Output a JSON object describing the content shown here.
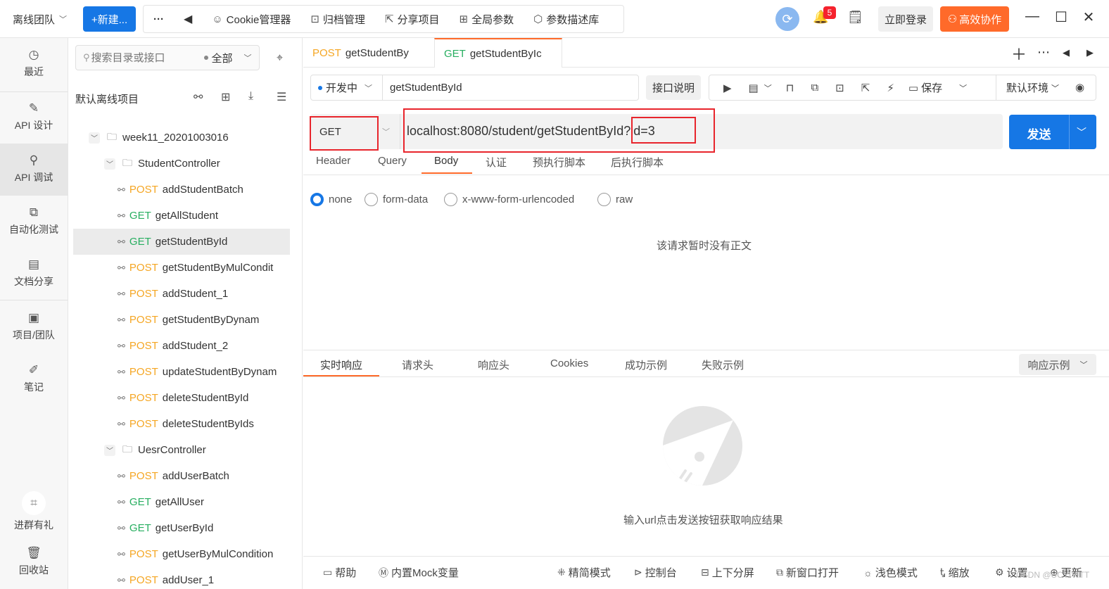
{
  "topbar": {
    "team": "离线团队",
    "new_label": "+新建...",
    "more_label": "···",
    "back_label": "◀",
    "tools": [
      {
        "icon": "cookie-icon",
        "glyph": "☺",
        "label": "Cookie管理器"
      },
      {
        "icon": "archive-icon",
        "glyph": "⊡",
        "label": "归档管理"
      },
      {
        "icon": "share-icon",
        "glyph": "⇱",
        "label": "分享项目"
      },
      {
        "icon": "params-icon",
        "glyph": "⊞",
        "label": "全局参数"
      },
      {
        "icon": "cube-icon",
        "glyph": "⬡",
        "label": "参数描述库"
      }
    ],
    "notification_count": "5",
    "login_label": "立即登录",
    "collab_label": "高效协作"
  },
  "rail": {
    "items": [
      {
        "label": "最近",
        "icon": "clock-icon",
        "glyph": "◷"
      },
      {
        "label": "API 设计",
        "icon": "edit-icon",
        "glyph": "✎"
      },
      {
        "label": "API 调试",
        "icon": "debug-icon",
        "glyph": "⚲"
      },
      {
        "label": "自动化测试",
        "icon": "flow-icon",
        "glyph": "⧉"
      },
      {
        "label": "文档分享",
        "icon": "doc-icon",
        "glyph": "▤"
      },
      {
        "label": "项目/团队",
        "icon": "project-icon",
        "glyph": "▣"
      },
      {
        "label": "笔记",
        "icon": "note-icon",
        "glyph": "✐"
      },
      {
        "label": "进群有礼",
        "icon": "group-icon",
        "glyph": "⌗"
      },
      {
        "label": "回收站",
        "icon": "trash-icon",
        "glyph": "🗑"
      }
    ]
  },
  "tree": {
    "search_placeholder": "搜索目录或接口",
    "filter_label": "全部",
    "project_title": "默认离线项目",
    "rows": [
      {
        "kind": "folder",
        "label": "week11_20201003016"
      },
      {
        "kind": "folder",
        "label": "StudentController"
      },
      {
        "kind": "api",
        "method": "POST",
        "label": "addStudentBatch"
      },
      {
        "kind": "api",
        "method": "GET",
        "label": "getAllStudent"
      },
      {
        "kind": "api",
        "method": "GET",
        "label": "getStudentById"
      },
      {
        "kind": "api",
        "method": "POST",
        "label": "getStudentByMulCondit"
      },
      {
        "kind": "api",
        "method": "POST",
        "label": "addStudent_1"
      },
      {
        "kind": "api",
        "method": "POST",
        "label": "getStudentByDynam"
      },
      {
        "kind": "api",
        "method": "POST",
        "label": "addStudent_2"
      },
      {
        "kind": "api",
        "method": "POST",
        "label": "updateStudentByDynam"
      },
      {
        "kind": "api",
        "method": "POST",
        "label": "deleteStudentById"
      },
      {
        "kind": "api",
        "method": "POST",
        "label": "deleteStudentByIds"
      },
      {
        "kind": "folder",
        "label": "UesrController"
      },
      {
        "kind": "api",
        "method": "POST",
        "label": "addUserBatch"
      },
      {
        "kind": "api",
        "method": "GET",
        "label": "getAllUser"
      },
      {
        "kind": "api",
        "method": "GET",
        "label": "getUserById"
      },
      {
        "kind": "api",
        "method": "POST",
        "label": "getUserByMulCondition"
      },
      {
        "kind": "api",
        "method": "POST",
        "label": "addUser_1"
      }
    ]
  },
  "tabs": [
    {
      "method": "POST",
      "label": "getStudentBy"
    },
    {
      "method": "GET",
      "label": "getStudentByIc"
    }
  ],
  "request": {
    "status": "开发中",
    "api_name": "getStudentById",
    "desc_label": "接口说明",
    "save_label": "保存",
    "env_label": "默认环境",
    "method": "GET",
    "url_base": "localhost:8080/student/getStudentById",
    "url_query": "?id=3",
    "send_label": "发送",
    "param_tabs": [
      "Header",
      "Query",
      "Body",
      "认证",
      "预执行脚本",
      "后执行脚本"
    ],
    "body_types": [
      "none",
      "form-data",
      "x-www-form-urlencoded",
      "raw"
    ],
    "no_body_text": "该请求暂时没有正文"
  },
  "response": {
    "tabs": [
      "实时响应",
      "请求头",
      "响应头",
      "Cookies",
      "成功示例",
      "失败示例"
    ],
    "example_label": "响应示例",
    "empty_hint": "输入url点击发送按钮获取响应结果"
  },
  "footer": {
    "items": [
      {
        "icon": "help-icon",
        "glyph": "▭",
        "label": "帮助"
      },
      {
        "icon": "mock-icon",
        "glyph": "Ⓜ",
        "label": "内置Mock变量"
      },
      {
        "icon": "simple-mode-icon",
        "glyph": "⁜",
        "label": "精简模式"
      },
      {
        "icon": "console-icon",
        "glyph": "⊳",
        "label": "控制台"
      },
      {
        "icon": "split-icon",
        "glyph": "⊟",
        "label": "上下分屏"
      },
      {
        "icon": "new-window-icon",
        "glyph": "⧉",
        "label": "新窗口打开"
      },
      {
        "icon": "theme-icon",
        "glyph": "☼",
        "label": "浅色模式"
      },
      {
        "icon": "zoom-icon",
        "glyph": "Ꮏ",
        "label": "缩放"
      },
      {
        "icon": "settings-icon",
        "glyph": "⚙",
        "label": "设置"
      },
      {
        "icon": "update-icon",
        "glyph": "⊕",
        "label": "更新"
      }
    ],
    "watermark": "CSDN @UCYIYITT"
  },
  "colors": {
    "accent_blue": "#1677e5",
    "accent_orange": "#ff6a2a",
    "post": "#f5a623",
    "get": "#27ae60",
    "highlight_red": "#e8252c"
  }
}
